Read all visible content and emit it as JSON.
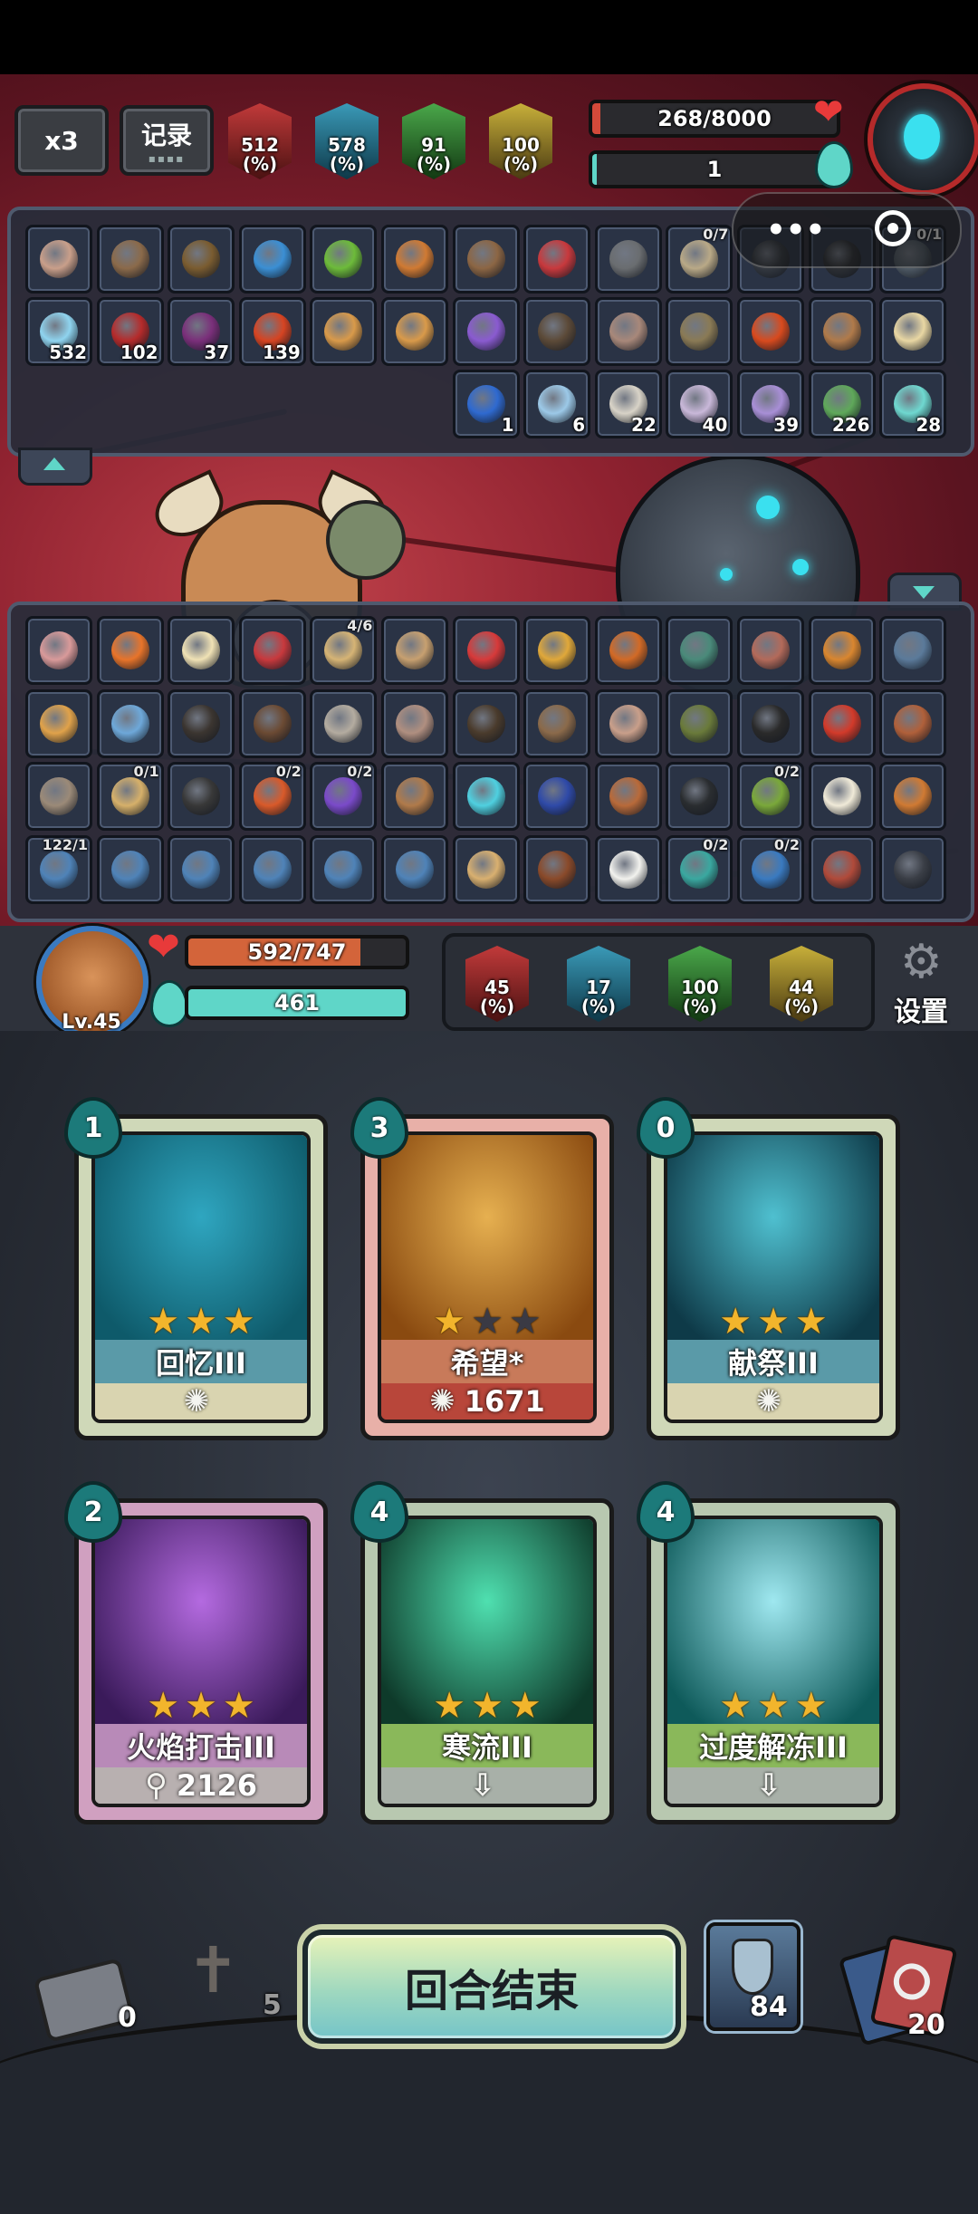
{
  "top_bar": {
    "speed_label": "x3",
    "log_label": "记录",
    "enemy_stats": [
      "512\n(%)",
      "578\n(%)",
      "91\n(%)",
      "100\n(%)"
    ],
    "enemy_hp": "268/8000",
    "enemy_hp_fraction": 0.0335,
    "enemy_energy": "1",
    "enemy_energy_fraction": 0.02
  },
  "enemy_panel": {
    "row1": [
      {
        "icon": "tied-captive-icon",
        "color": "#c99f8a"
      },
      {
        "icon": "spiked-bomb-icon",
        "color": "#8b6a4a"
      },
      {
        "icon": "potion-sack-icon",
        "color": "#7a5c30"
      },
      {
        "icon": "blue-blade-icon",
        "color": "#3b8fd4"
      },
      {
        "icon": "green-slime-icon",
        "color": "#6dbb3a"
      },
      {
        "icon": "red-scroll-icon",
        "color": "#d07a33"
      },
      {
        "icon": "brown-book-icon",
        "color": "#8c6644"
      },
      {
        "icon": "red-demon-icon",
        "color": "#c8393d"
      },
      {
        "icon": "arrow-bundle-icon",
        "color": "#6a6d70"
      },
      {
        "icon": "pocket-watch-icon",
        "color": "#b9a987",
        "frac": "0/7"
      },
      {
        "icon": "dark-claw-icon",
        "color": "#333840"
      },
      {
        "icon": "black-cloak-icon",
        "color": "#2c2f34"
      },
      {
        "icon": "hooked-chain-icon",
        "color": "#4e5964",
        "frac": "0/1"
      }
    ],
    "row2": [
      {
        "icon": "snowflake-icon",
        "color": "#8fd4ef",
        "count": "532"
      },
      {
        "icon": "claw-slash-icon",
        "color": "#b52b2b",
        "count": "102"
      },
      {
        "icon": "down-arrow-icon",
        "color": "#7a2f7a",
        "count": "37"
      },
      {
        "icon": "flame-icon",
        "color": "#d64422",
        "count": "139"
      },
      {
        "icon": "amber-crystal-icon",
        "color": "#d99a4a"
      },
      {
        "icon": "amber-crystal-icon",
        "color": "#d99a4a"
      },
      {
        "icon": "purple-gem-icon",
        "color": "#8a5bd0"
      },
      {
        "icon": "dagger-icon",
        "color": "#5c4a38"
      },
      {
        "icon": "beast-head-icon",
        "color": "#a8887a"
      },
      {
        "icon": "brown-golem-icon",
        "color": "#8a7a55"
      },
      {
        "icon": "fire-bird-icon",
        "color": "#d84a1e"
      },
      {
        "icon": "mole-icon",
        "color": "#b07a4a"
      },
      {
        "icon": "ice-cream-icon",
        "color": "#e9d7a3"
      }
    ],
    "row3": [
      {
        "icon": "blue-shield-icon",
        "color": "#2f6ad0",
        "count": "1"
      },
      {
        "icon": "ice-orb-icon",
        "color": "#9cc9e8",
        "count": "6"
      },
      {
        "icon": "paper-stack-icon",
        "color": "#d8d3c7",
        "count": "22"
      },
      {
        "icon": "spiral-target-icon",
        "color": "#c9b8d9",
        "count": "40"
      },
      {
        "icon": "mushroom-icon",
        "color": "#a88fd6",
        "count": "39"
      },
      {
        "icon": "skull-icon",
        "color": "#5fa85a",
        "count": "226"
      },
      {
        "icon": "crosshair-icon",
        "color": "#6fd8d0",
        "count": "28"
      }
    ]
  },
  "player_panel": {
    "rows": [
      [
        {
          "icon": "chicken-icon",
          "color": "#d99a9a"
        },
        {
          "icon": "fire-teapot-icon",
          "color": "#e8742a"
        },
        {
          "icon": "ice-cream-icon",
          "color": "#f0e2b5"
        },
        {
          "icon": "red-demon-icon",
          "color": "#c8393d"
        },
        {
          "icon": "map-scroll-icon",
          "color": "#d6b475",
          "frac": "4/6"
        },
        {
          "icon": "orb-claw-icon",
          "color": "#c7a070"
        },
        {
          "icon": "red-blade-icon",
          "color": "#d73a3a"
        },
        {
          "icon": "golden-blade-icon",
          "color": "#e0a83a"
        },
        {
          "icon": "fire-bomb-icon",
          "color": "#d26a26"
        },
        {
          "icon": "fish-icon",
          "color": "#4a8a7a"
        },
        {
          "icon": "doll-icon",
          "color": "#b36a5a"
        },
        {
          "icon": "fire-crab-icon",
          "color": "#d9862f"
        },
        {
          "icon": "hammer-icon",
          "color": "#5b7a9a"
        }
      ],
      [
        {
          "icon": "bread-icon",
          "color": "#e0a24a"
        },
        {
          "icon": "party-horn-icon",
          "color": "#6ea8d9"
        },
        {
          "icon": "dark-glove-icon",
          "color": "#3b3530"
        },
        {
          "icon": "coin-pouch-icon",
          "color": "#6b4a33"
        },
        {
          "icon": "teacup-icon",
          "color": "#b4aca0"
        },
        {
          "icon": "beast-head-icon",
          "color": "#b08f80"
        },
        {
          "icon": "dagger-icon",
          "color": "#4a3b2c"
        },
        {
          "icon": "spiked-bomb-icon",
          "color": "#8b6a4a"
        },
        {
          "icon": "tied-captive-icon",
          "color": "#c99f8a"
        },
        {
          "icon": "beetle-icon",
          "color": "#6a7a3a"
        },
        {
          "icon": "eye-mask-icon",
          "color": "#2a2a2a"
        },
        {
          "icon": "red-apple-icon",
          "color": "#d23a2a"
        },
        {
          "icon": "meat-bone-icon",
          "color": "#b0603a"
        }
      ],
      [
        {
          "icon": "spiral-shell-icon",
          "color": "#9b8a78"
        },
        {
          "icon": "pacifier-icon",
          "color": "#d6b06a",
          "frac": "0/1"
        },
        {
          "icon": "wire-frame-icon",
          "color": "#383838"
        },
        {
          "icon": "fire-banner-icon",
          "color": "#d95a2a",
          "frac": "0/2"
        },
        {
          "icon": "purple-banner-icon",
          "color": "#7a4ac9",
          "frac": "0/2"
        },
        {
          "icon": "mole-icon",
          "color": "#b07a4a"
        },
        {
          "icon": "ice-orb-icon",
          "color": "#4fd0e0"
        },
        {
          "icon": "lightning-card-icon",
          "color": "#2f4aa8"
        },
        {
          "icon": "cookie-icon",
          "color": "#b86a3a"
        },
        {
          "icon": "black-bowling-ball-icon",
          "color": "#2a2d30"
        },
        {
          "icon": "green-banner-icon",
          "color": "#7aa83a",
          "frac": "0/2"
        },
        {
          "icon": "bone-icon",
          "color": "#f0ead8"
        },
        {
          "icon": "red-scroll-icon",
          "color": "#d07a33"
        }
      ],
      [
        {
          "icon": "blue-rune-card-icon",
          "color": "#4f83b8",
          "frac": "122/1"
        },
        {
          "icon": "blue-rune-card-icon",
          "color": "#4f83b8"
        },
        {
          "icon": "blue-rune-card-icon",
          "color": "#4f83b8"
        },
        {
          "icon": "blue-rune-card-icon",
          "color": "#4f83b8"
        },
        {
          "icon": "blue-rune-card-icon",
          "color": "#4f83b8"
        },
        {
          "icon": "blue-rune-card-icon",
          "color": "#4f83b8"
        },
        {
          "icon": "adventurer-icon",
          "color": "#d9b070"
        },
        {
          "icon": "leather-bag-icon",
          "color": "#8a4a2a"
        },
        {
          "icon": "rice-ball-icon",
          "color": "#f2f2ee"
        },
        {
          "icon": "teal-banner-icon",
          "color": "#3aa8a0",
          "frac": "0/2"
        },
        {
          "icon": "blue-banner-icon",
          "color": "#3a7ac0",
          "frac": "0/2"
        },
        {
          "icon": "ham-icon",
          "color": "#b04a3a"
        },
        {
          "icon": "black-crystal-icon",
          "color": "#3a3e46"
        }
      ]
    ]
  },
  "player": {
    "level": "Lv.45",
    "hp": "592/747",
    "hp_fraction": 0.79,
    "energy": "461",
    "energy_fraction": 1.0,
    "stats": [
      "45\n(%)",
      "17\n(%)",
      "100\n(%)",
      "44\n(%)"
    ],
    "settings_label": "设置"
  },
  "hand": [
    {
      "cost": "1",
      "name": "回忆III",
      "stars": 3,
      "footer": "",
      "footer_icon": "gear-light-icon",
      "theme": "teal",
      "art": "#2fa6c0",
      "art2": "#0e5a6a"
    },
    {
      "cost": "3",
      "name": "希望*",
      "stars": 1,
      "footer": "1671",
      "footer_icon": "gear-light-icon",
      "theme": "red",
      "art": "#e6b050",
      "art2": "#8a4a10"
    },
    {
      "cost": "0",
      "name": "献祭III",
      "stars": 3,
      "footer": "",
      "footer_icon": "gear-light-icon",
      "theme": "teal",
      "art": "#4fc0d0",
      "art2": "#0e3a48"
    },
    {
      "cost": "2",
      "name": "火焰打击III",
      "stars": 3,
      "footer": "2126",
      "footer_icon": "hook-icon",
      "theme": "purple",
      "art": "#b46ae0",
      "art2": "#3a1a5a"
    },
    {
      "cost": "4",
      "name": "寒流III",
      "stars": 3,
      "footer": "",
      "footer_icon": "down-arrow-icon",
      "theme": "green",
      "art": "#4fe0b0",
      "art2": "#0e3a2a"
    },
    {
      "cost": "4",
      "name": "过度解冻III",
      "stars": 3,
      "footer": "",
      "footer_icon": "down-arrow-icon",
      "theme": "green",
      "art": "#9fe8f0",
      "art2": "#0e5a5a"
    }
  ],
  "bottom": {
    "exhaust_count": "0",
    "grave_count": "5",
    "end_turn_label": "回合结束",
    "draw_count": "84",
    "discard_count": "20"
  },
  "colors": {
    "teal": "#5fd6c8",
    "hp_red": "#d34a3a",
    "gold_star": "#f2b52c"
  }
}
